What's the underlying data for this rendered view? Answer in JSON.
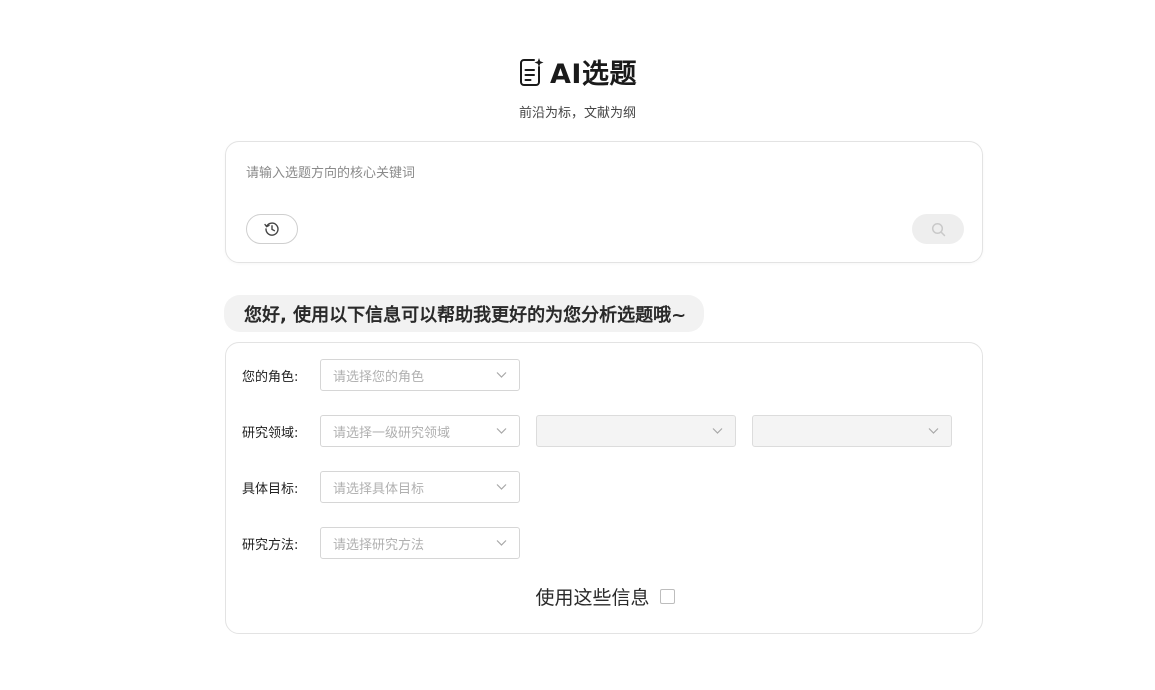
{
  "header": {
    "title": "AI选题",
    "subtitle": "前沿为标，文献为纲",
    "logo_icon": "document-sparkle-icon"
  },
  "search": {
    "placeholder": "请输入选题方向的核心关键词",
    "value": "",
    "history_icon": "history-clock-icon",
    "search_icon": "search-icon"
  },
  "greeting": {
    "text": "您好, 使用以下信息可以帮助我更好的为您分析选题哦~"
  },
  "form": {
    "role": {
      "label": "您的角色:",
      "placeholder": "请选择您的角色"
    },
    "field": {
      "label": "研究领域:",
      "level1_placeholder": "请选择一级研究领域",
      "level2_placeholder": "",
      "level3_placeholder": ""
    },
    "goal": {
      "label": "具体目标:",
      "placeholder": "请选择具体目标"
    },
    "method": {
      "label": "研究方法:",
      "placeholder": "请选择研究方法"
    },
    "use_info": {
      "label": "使用这些信息",
      "checked": false
    }
  },
  "colors": {
    "accent_bg": "#f2f2f2",
    "border": "#e3e3e3",
    "placeholder_text": "#b0b0b0"
  }
}
